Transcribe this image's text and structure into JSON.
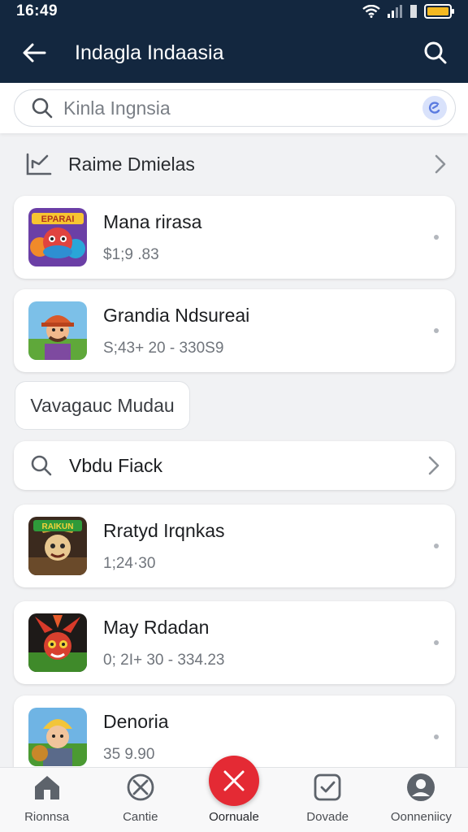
{
  "status_bar": {
    "time": "16:49"
  },
  "app_bar": {
    "title": "Indagla Indaasia",
    "back_icon": "arrow-left-icon",
    "search_icon": "search-icon"
  },
  "search": {
    "placeholder": "Kinla Ingnsia",
    "icon": "search-icon",
    "voice_icon": "assistant-icon"
  },
  "section": {
    "label": "Raime Dmielas",
    "icon": "chart-icon"
  },
  "apps_top": [
    {
      "name": "Mana rirasa",
      "subtitle": "$1;9 .83",
      "icon_label": "EPARAI"
    },
    {
      "name": "Grandia Ndsureai",
      "subtitle": "S;43+ 20 - 330S9"
    }
  ],
  "chip": {
    "label": "Vavagauc Mudau"
  },
  "search_row": {
    "label": "Vbdu Fiack"
  },
  "apps_bottom": [
    {
      "name": "Rratyd Irqnkas",
      "subtitle": "1;24·30",
      "icon_label": "RAIKUN"
    },
    {
      "name": "May Rdadan",
      "subtitle": "0; 2I+ 30 - 334.23"
    },
    {
      "name": "Denoria",
      "subtitle": "35 9.90"
    }
  ],
  "bottom_nav": [
    {
      "label": "Rionnsa",
      "icon": "home-icon"
    },
    {
      "label": "Cantie",
      "icon": "cancel-circle-icon"
    },
    {
      "label": "Oornuale",
      "icon": "close-icon"
    },
    {
      "label": "Dovade",
      "icon": "clock-box-icon"
    },
    {
      "label": "Oonneniicy",
      "icon": "profile-icon"
    }
  ],
  "colors": {
    "header": "#13273f",
    "accent": "#e42a34",
    "background": "#f1f2f4"
  }
}
